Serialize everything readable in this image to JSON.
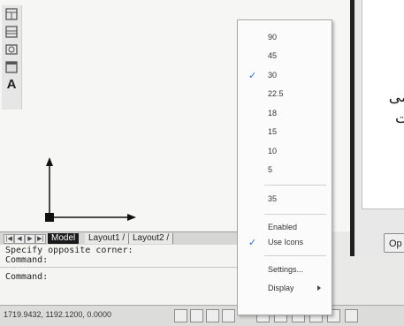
{
  "menu": {
    "angles": [
      {
        "label": "90",
        "checked": false
      },
      {
        "label": "45",
        "checked": false
      },
      {
        "label": "30",
        "checked": true
      },
      {
        "label": "22.5",
        "checked": false
      },
      {
        "label": "18",
        "checked": false
      },
      {
        "label": "15",
        "checked": false
      },
      {
        "label": "10",
        "checked": false
      },
      {
        "label": "5",
        "checked": false
      }
    ],
    "custom_angle": "35",
    "enabled": "Enabled",
    "use_icons": "Use Icons",
    "use_icons_checked": true,
    "settings": "Settings...",
    "display": "Display",
    "check_glyph": "✓"
  },
  "tabs": {
    "model": "Model",
    "layout1": "Layout1",
    "layout2": "Layout2",
    "separator": "/"
  },
  "command": {
    "line1": "Specify opposite corner:",
    "line2": "Command:",
    "prompt": "Command:"
  },
  "status": {
    "coordinates": "1719.9432, 1192.1200, 0.0000"
  },
  "dialog": {
    "text_line1": "می",
    "text_line2": "ت",
    "button_label": "Op"
  },
  "toolbar": {
    "text_tool": "A",
    "icons": [
      "table-icon",
      "table-icon",
      "insert-block-icon",
      "image-icon",
      "text-icon"
    ]
  },
  "colors": {
    "check": "#2f6fc9",
    "model_tab": "#1a1a1a"
  }
}
